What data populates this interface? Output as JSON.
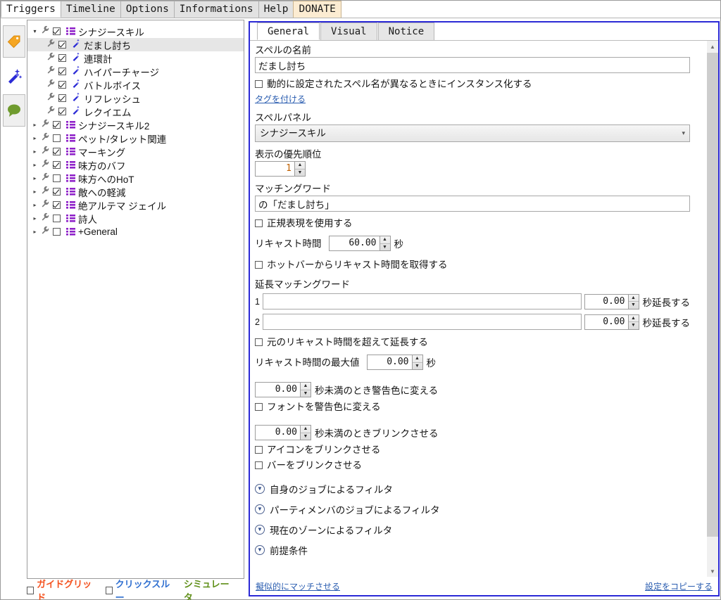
{
  "menu": {
    "tabs": [
      {
        "label": "Triggers",
        "active": true
      },
      {
        "label": "Timeline",
        "active": false
      },
      {
        "label": "Options",
        "active": false
      },
      {
        "label": "Informations",
        "active": false
      },
      {
        "label": "Help",
        "active": false
      },
      {
        "label": "DONATE",
        "active": false,
        "accent": "#fcecd2"
      }
    ]
  },
  "rail": {
    "items": [
      {
        "name": "tag-icon",
        "glyph": "tag"
      },
      {
        "name": "wand-icon",
        "glyph": "wand"
      },
      {
        "name": "chat-icon",
        "glyph": "chat"
      }
    ]
  },
  "tree": {
    "items": [
      {
        "label": "シナジースキル",
        "depth": 0,
        "arrow": "open",
        "checked": true,
        "icon": "grid"
      },
      {
        "label": "だまし討ち",
        "depth": 1,
        "arrow": "none",
        "checked": true,
        "icon": "wand",
        "selected": true
      },
      {
        "label": "連環計",
        "depth": 1,
        "arrow": "none",
        "checked": true,
        "icon": "wand"
      },
      {
        "label": "ハイパーチャージ",
        "depth": 1,
        "arrow": "none",
        "checked": true,
        "icon": "wand"
      },
      {
        "label": "バトルボイス",
        "depth": 1,
        "arrow": "none",
        "checked": true,
        "icon": "wand"
      },
      {
        "label": "リフレッシュ",
        "depth": 1,
        "arrow": "none",
        "checked": true,
        "icon": "wand"
      },
      {
        "label": "レクイエム",
        "depth": 1,
        "arrow": "none",
        "checked": true,
        "icon": "wand"
      },
      {
        "label": "シナジースキル2",
        "depth": 0,
        "arrow": "closed",
        "checked": true,
        "icon": "grid"
      },
      {
        "label": "ペット/タレット関連",
        "depth": 0,
        "arrow": "closed",
        "checked": false,
        "icon": "grid"
      },
      {
        "label": "マーキング",
        "depth": 0,
        "arrow": "closed",
        "checked": true,
        "icon": "grid"
      },
      {
        "label": "味方のバフ",
        "depth": 0,
        "arrow": "closed",
        "checked": true,
        "icon": "grid"
      },
      {
        "label": "味方へのHoT",
        "depth": 0,
        "arrow": "closed",
        "checked": false,
        "icon": "grid"
      },
      {
        "label": "敵への軽減",
        "depth": 0,
        "arrow": "closed",
        "checked": true,
        "icon": "grid"
      },
      {
        "label": "絶アルテマ ジェイル",
        "depth": 0,
        "arrow": "closed",
        "checked": true,
        "icon": "grid"
      },
      {
        "label": "詩人",
        "depth": 0,
        "arrow": "closed",
        "checked": false,
        "icon": "grid"
      },
      {
        "label": "+General",
        "depth": 0,
        "arrow": "closed",
        "checked": false,
        "icon": "grid"
      }
    ]
  },
  "left_toolbar": {
    "guide_grid": "ガイドグリッド",
    "click_through": "クリックスルー",
    "simulator": "シミュレータ",
    "guide_grid_color": "#f4511e",
    "click_through_color": "#2f6fd0",
    "simulator_color": "#5f8f18"
  },
  "detail": {
    "tabs": [
      {
        "label": "General",
        "active": true
      },
      {
        "label": "Visual",
        "active": false
      },
      {
        "label": "Notice",
        "active": false
      }
    ],
    "spell_name_label": "スペルの名前",
    "spell_name_value": "だまし討ち",
    "instance_checkbox_label": "動的に設定されたスペル名が異なるときにインスタンス化する",
    "tag_link": "タグを付ける",
    "spell_panel_label": "スペルパネル",
    "spell_panel_value": "シナジースキル",
    "priority_label": "表示の優先順位",
    "priority_value": "1",
    "matching_word_label": "マッチングワード",
    "matching_word_value": "の「だまし討ち」",
    "regex_checkbox_label": "正規表現を使用する",
    "recast_label": "リキャスト時間",
    "recast_value": "60.00",
    "recast_unit": "秒",
    "hotbar_checkbox_label": "ホットバーからリキャスト時間を取得する",
    "extend_label": "延長マッチングワード",
    "extend_rows": [
      {
        "num": "1",
        "word": "",
        "seconds": "0.00",
        "unit": "秒延長する"
      },
      {
        "num": "2",
        "word": "",
        "seconds": "0.00",
        "unit": "秒延長する"
      }
    ],
    "over_original_checkbox_label": "元のリキャスト時間を超えて延長する",
    "max_recast_label": "リキャスト時間の最大値",
    "max_recast_value": "0.00",
    "max_recast_unit": "秒",
    "warn_color_value": "0.00",
    "warn_color_label": "秒未満のとき警告色に変える",
    "warn_font_checkbox_label": "フォントを警告色に変える",
    "blink_value": "0.00",
    "blink_label": "秒未満のときブリンクさせる",
    "blink_icon_checkbox_label": "アイコンをブリンクさせる",
    "blink_bar_checkbox_label": "バーをブリンクさせる",
    "sections": [
      "自身のジョブによるフィルタ",
      "パーティメンバのジョブによるフィルタ",
      "現在のゾーンによるフィルタ",
      "前提条件"
    ],
    "footer_left_link": "擬似的にマッチさせる",
    "footer_right_link": "設定をコピーする"
  }
}
